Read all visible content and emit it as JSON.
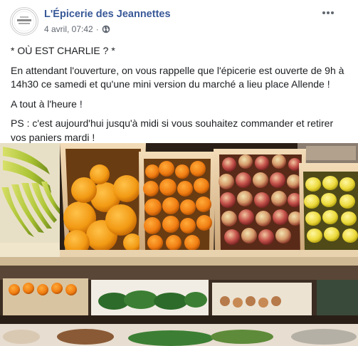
{
  "post": {
    "page_name": "L'Épicerie des Jeannettes",
    "date": "4 avril, 07:42",
    "separator": "·",
    "audience_icon": "globe-icon",
    "more_icon": "more-horizontal-icon",
    "avatar_logo_text": "L'ÉPICERIE des Jeannettes",
    "paragraphs": [
      "* OÙ EST CHARLIE ? *",
      "En attendant l'ouverture, on vous rappelle que l'épicerie est ouverte de 9h à 14h30 ce samedi et qu'une mini version du marché a lieu place Allende !",
      "A tout à l'heure !",
      "PS : c'est aujourd'hui jusqu'à midi si vous souhaitez commander et retirer vos paniers mardi !"
    ],
    "photo_subject": "fruit-crates-photo"
  },
  "colors": {
    "link": "#385898",
    "meta": "#606770",
    "text": "#1c1e21"
  }
}
